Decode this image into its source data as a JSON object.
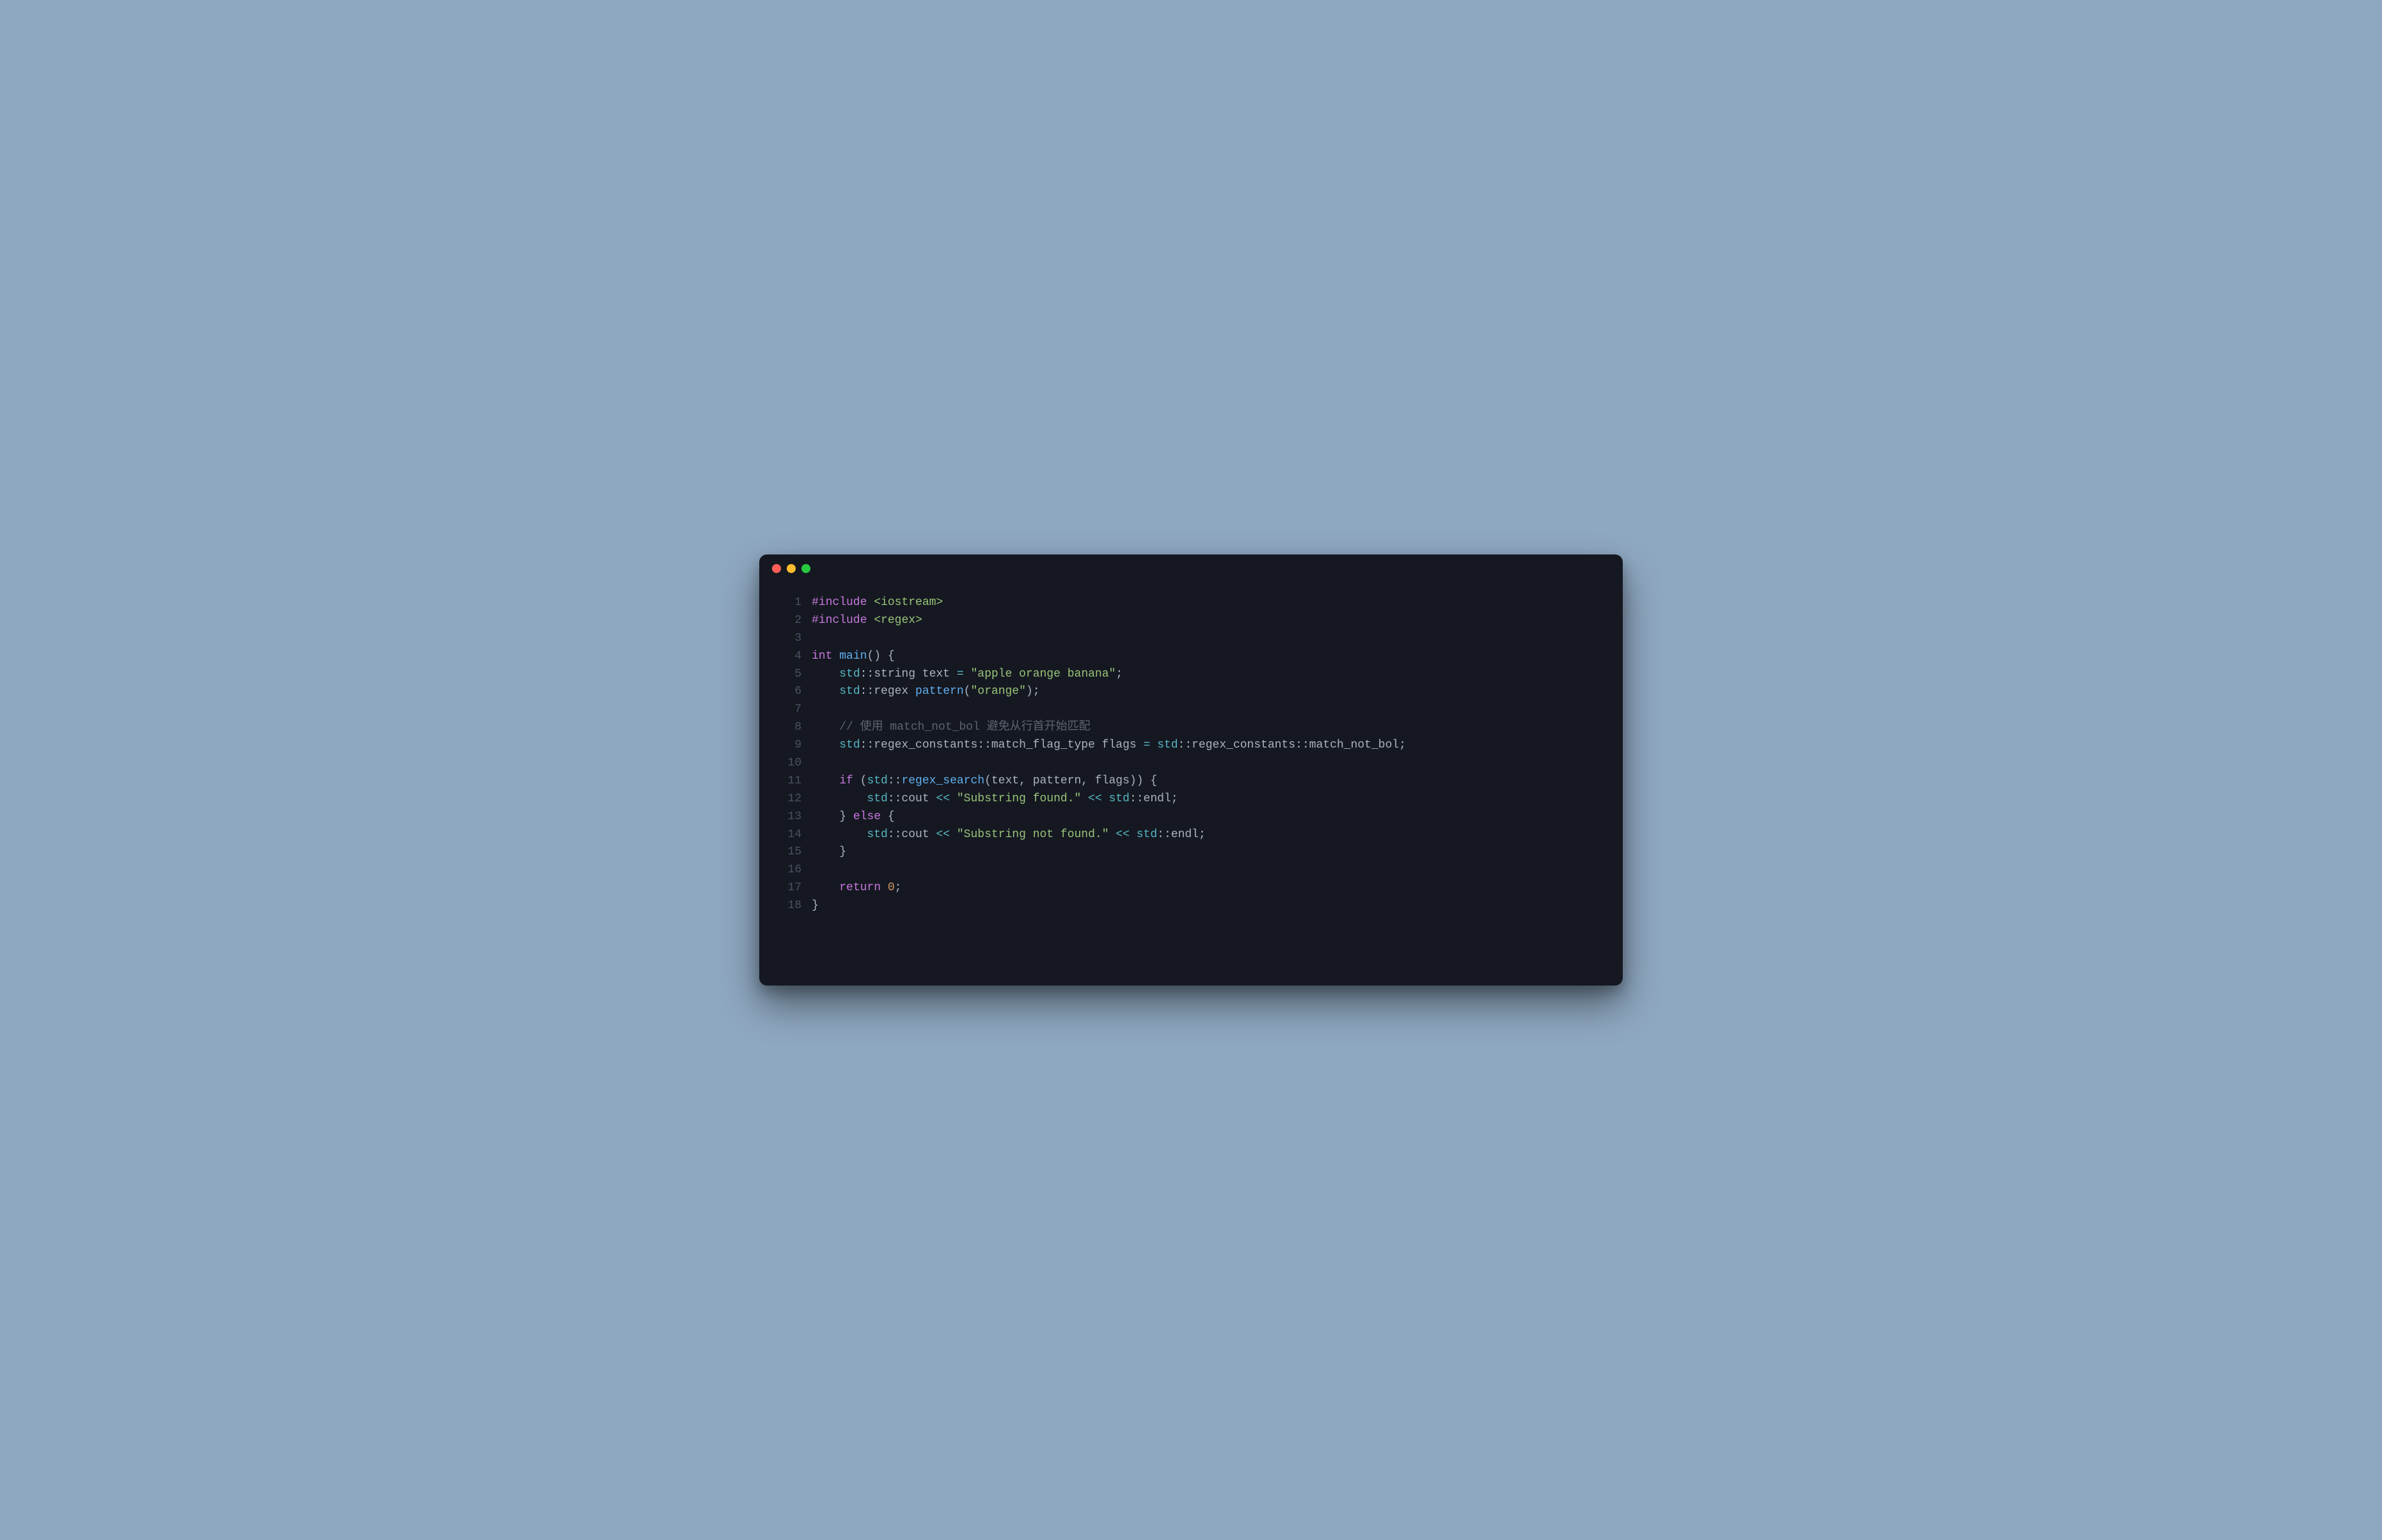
{
  "colors": {
    "red": "#ff5f56",
    "yellow": "#ffbd2e",
    "green": "#27c93f"
  },
  "lines": [
    {
      "n": "1",
      "tokens": [
        {
          "c": "pre",
          "t": "#include"
        },
        {
          "c": "punct",
          "t": " "
        },
        {
          "c": "incpath",
          "t": "<iostream>"
        }
      ]
    },
    {
      "n": "2",
      "tokens": [
        {
          "c": "pre",
          "t": "#include"
        },
        {
          "c": "punct",
          "t": " "
        },
        {
          "c": "incpath",
          "t": "<regex>"
        }
      ]
    },
    {
      "n": "3",
      "tokens": []
    },
    {
      "n": "4",
      "tokens": [
        {
          "c": "type",
          "t": "int"
        },
        {
          "c": "punct",
          "t": " "
        },
        {
          "c": "fn",
          "t": "main"
        },
        {
          "c": "punct",
          "t": "() {"
        }
      ]
    },
    {
      "n": "5",
      "tokens": [
        {
          "c": "punct",
          "t": "    "
        },
        {
          "c": "ns",
          "t": "std"
        },
        {
          "c": "punct",
          "t": "::string text "
        },
        {
          "c": "op",
          "t": "="
        },
        {
          "c": "punct",
          "t": " "
        },
        {
          "c": "str",
          "t": "\"apple orange banana\""
        },
        {
          "c": "punct",
          "t": ";"
        }
      ]
    },
    {
      "n": "6",
      "tokens": [
        {
          "c": "punct",
          "t": "    "
        },
        {
          "c": "ns",
          "t": "std"
        },
        {
          "c": "punct",
          "t": "::regex "
        },
        {
          "c": "fn",
          "t": "pattern"
        },
        {
          "c": "punct",
          "t": "("
        },
        {
          "c": "str",
          "t": "\"orange\""
        },
        {
          "c": "punct",
          "t": ");"
        }
      ]
    },
    {
      "n": "7",
      "tokens": []
    },
    {
      "n": "8",
      "tokens": [
        {
          "c": "punct",
          "t": "    "
        },
        {
          "c": "cmt",
          "t": "// 使用 match_not_bol 避免从行首开始匹配"
        }
      ]
    },
    {
      "n": "9",
      "tokens": [
        {
          "c": "punct",
          "t": "    "
        },
        {
          "c": "ns",
          "t": "std"
        },
        {
          "c": "punct",
          "t": "::regex_constants::match_flag_type flags "
        },
        {
          "c": "op",
          "t": "="
        },
        {
          "c": "punct",
          "t": " "
        },
        {
          "c": "ns",
          "t": "std"
        },
        {
          "c": "punct",
          "t": "::regex_constants::match_not_bol;"
        }
      ]
    },
    {
      "n": "10",
      "tokens": []
    },
    {
      "n": "11",
      "tokens": [
        {
          "c": "punct",
          "t": "    "
        },
        {
          "c": "kw",
          "t": "if"
        },
        {
          "c": "punct",
          "t": " ("
        },
        {
          "c": "ns",
          "t": "std"
        },
        {
          "c": "punct",
          "t": "::"
        },
        {
          "c": "fn",
          "t": "regex_search"
        },
        {
          "c": "punct",
          "t": "(text, pattern, flags)) {"
        }
      ]
    },
    {
      "n": "12",
      "tokens": [
        {
          "c": "punct",
          "t": "        "
        },
        {
          "c": "ns",
          "t": "std"
        },
        {
          "c": "punct",
          "t": "::cout "
        },
        {
          "c": "op",
          "t": "<<"
        },
        {
          "c": "punct",
          "t": " "
        },
        {
          "c": "str",
          "t": "\"Substring found.\""
        },
        {
          "c": "punct",
          "t": " "
        },
        {
          "c": "op",
          "t": "<<"
        },
        {
          "c": "punct",
          "t": " "
        },
        {
          "c": "ns",
          "t": "std"
        },
        {
          "c": "punct",
          "t": "::endl;"
        }
      ]
    },
    {
      "n": "13",
      "tokens": [
        {
          "c": "punct",
          "t": "    } "
        },
        {
          "c": "kw",
          "t": "else"
        },
        {
          "c": "punct",
          "t": " {"
        }
      ]
    },
    {
      "n": "14",
      "tokens": [
        {
          "c": "punct",
          "t": "        "
        },
        {
          "c": "ns",
          "t": "std"
        },
        {
          "c": "punct",
          "t": "::cout "
        },
        {
          "c": "op",
          "t": "<<"
        },
        {
          "c": "punct",
          "t": " "
        },
        {
          "c": "str",
          "t": "\"Substring not found.\""
        },
        {
          "c": "punct",
          "t": " "
        },
        {
          "c": "op",
          "t": "<<"
        },
        {
          "c": "punct",
          "t": " "
        },
        {
          "c": "ns",
          "t": "std"
        },
        {
          "c": "punct",
          "t": "::endl;"
        }
      ]
    },
    {
      "n": "15",
      "tokens": [
        {
          "c": "punct",
          "t": "    }"
        }
      ]
    },
    {
      "n": "16",
      "tokens": []
    },
    {
      "n": "17",
      "tokens": [
        {
          "c": "punct",
          "t": "    "
        },
        {
          "c": "kw",
          "t": "return"
        },
        {
          "c": "punct",
          "t": " "
        },
        {
          "c": "num",
          "t": "0"
        },
        {
          "c": "punct",
          "t": ";"
        }
      ]
    },
    {
      "n": "18",
      "tokens": [
        {
          "c": "punct",
          "t": "}"
        }
      ]
    }
  ]
}
